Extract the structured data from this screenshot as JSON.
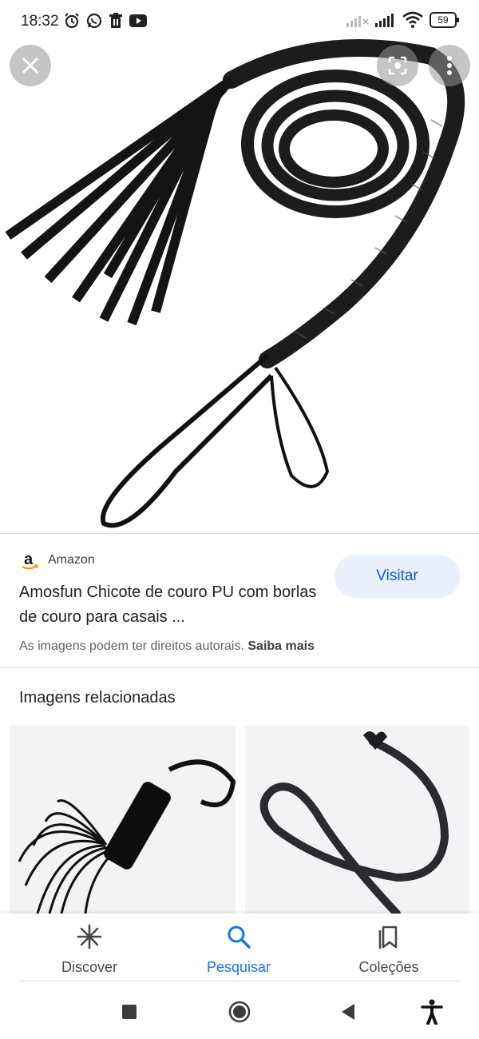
{
  "status_bar": {
    "time": "18:32",
    "battery": "59",
    "icons": [
      "alarm-icon",
      "whatsapp-icon",
      "trash-icon",
      "youtube-icon",
      "signal-icon",
      "wifi-icon",
      "battery-icon"
    ]
  },
  "viewer": {
    "close_icon": "close-icon",
    "lens_icon": "lens-icon",
    "more_icon": "more-vert-icon"
  },
  "source": {
    "name": "Amazon",
    "logo_text": "a",
    "title": "Amosfun Chicote de couro PU com borlas de couro para casais ...",
    "visit_label": "Visitar",
    "copyright_text": "As imagens podem ter direitos autorais.",
    "learn_more": "Saiba mais"
  },
  "related": {
    "heading": "Imagens relacionadas"
  },
  "bottom_nav": {
    "items": [
      {
        "label": "Discover",
        "icon": "asterisk-icon",
        "active": false
      },
      {
        "label": "Pesquisar",
        "icon": "search-icon",
        "active": true
      },
      {
        "label": "Coleções",
        "icon": "bookmark-icon",
        "active": false
      }
    ]
  },
  "system_nav": {
    "icons": [
      "recents-square-icon",
      "home-circle-icon",
      "back-triangle-icon",
      "accessibility-icon"
    ]
  },
  "colors": {
    "accent": "#1a73e8",
    "visit_bg": "#e8f0fe",
    "visit_text": "#1a57c6"
  }
}
